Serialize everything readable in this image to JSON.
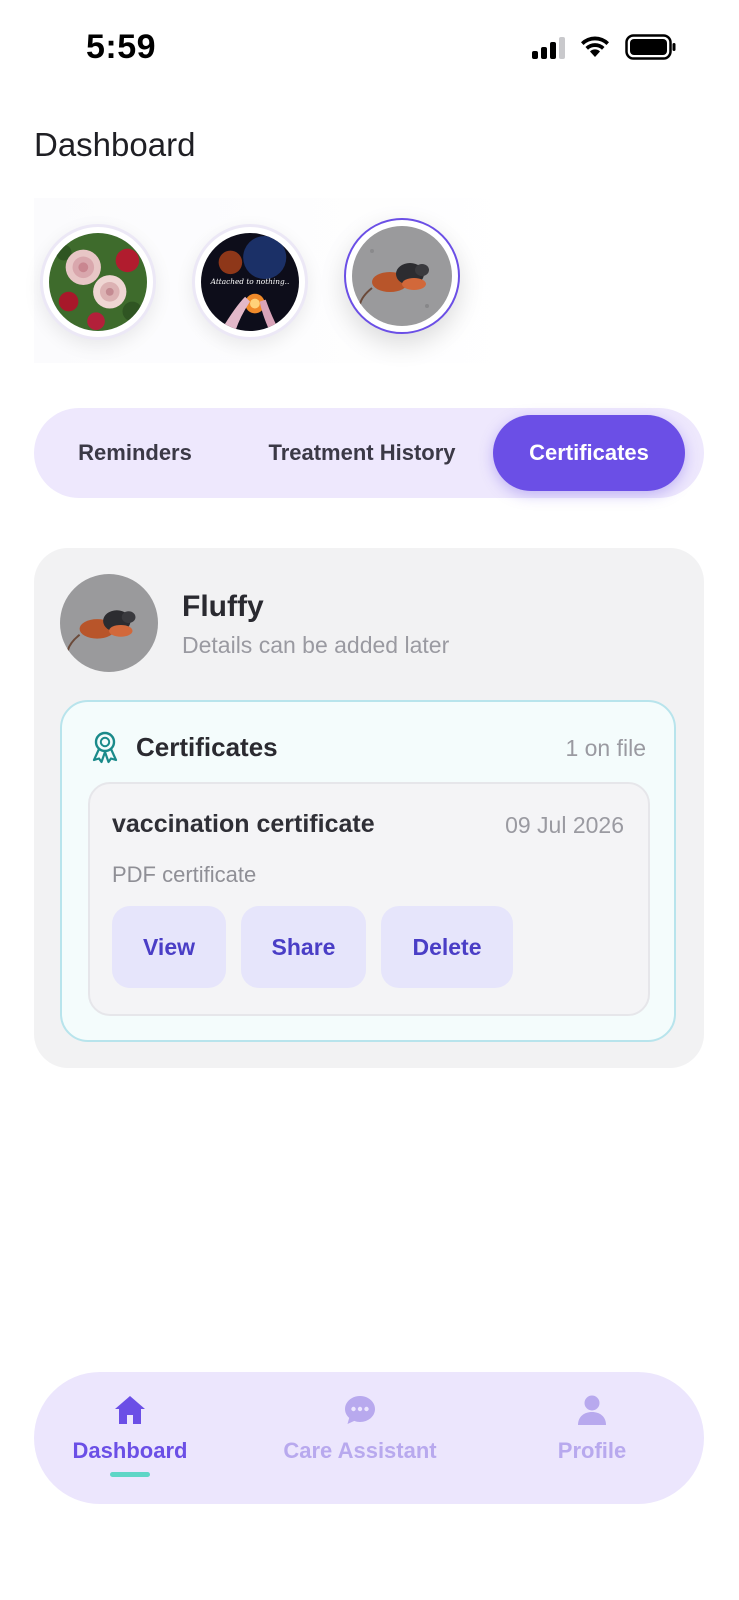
{
  "status_bar": {
    "time": "5:59"
  },
  "page": {
    "title": "Dashboard"
  },
  "pets": [
    {
      "name": "pet-1",
      "selected": false
    },
    {
      "name": "pet-2",
      "selected": false,
      "photo_caption": "Attached to nothing.."
    },
    {
      "name": "pet-3",
      "selected": true
    }
  ],
  "tabs": [
    {
      "label": "Reminders",
      "active": false
    },
    {
      "label": "Treatment History",
      "active": false
    },
    {
      "label": "Certificates",
      "active": true
    }
  ],
  "pet_card": {
    "name": "Fluffy",
    "subtitle": "Details can be added later",
    "certificates": {
      "title": "Certificates",
      "count_label": "1 on file",
      "items": [
        {
          "name": "vaccination certificate",
          "date": "09 Jul 2026",
          "type": "PDF certificate",
          "actions": {
            "view": "View",
            "share": "Share",
            "delete": "Delete"
          }
        }
      ]
    }
  },
  "nav": {
    "items": [
      {
        "label": "Dashboard",
        "icon": "home-icon",
        "active": true
      },
      {
        "label": "Care Assistant",
        "icon": "chat-icon",
        "active": false
      },
      {
        "label": "Profile",
        "icon": "person-icon",
        "active": false
      }
    ]
  },
  "colors": {
    "accent": "#6b4fe6",
    "tab_track": "#eee8fd",
    "nav_bg": "#ece6fd",
    "cert_border": "#b8e4ec",
    "button_bg": "#e6e5fb",
    "indicator": "#5fd6c6"
  }
}
